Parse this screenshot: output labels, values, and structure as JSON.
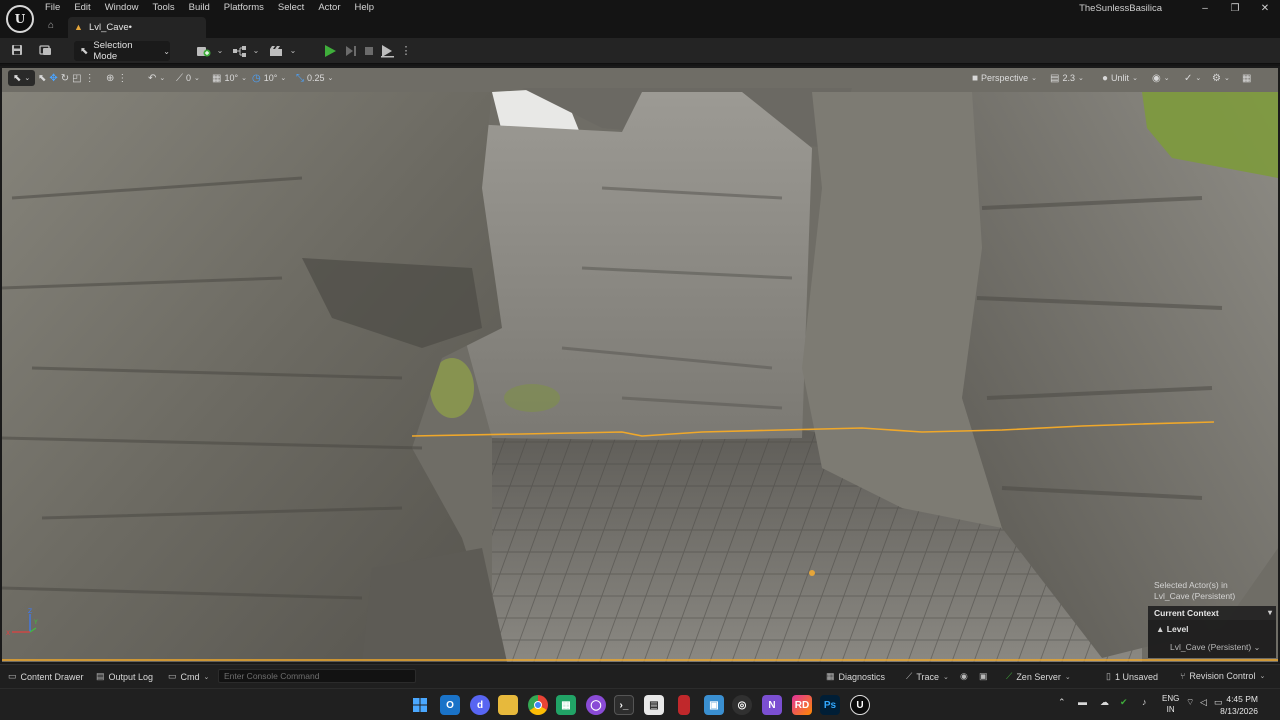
{
  "window": {
    "project_name": "TheSunlessBasilica",
    "menu": [
      "File",
      "Edit",
      "Window",
      "Tools",
      "Build",
      "Platforms",
      "Select",
      "Actor",
      "Help"
    ],
    "tab_label": "Lvl_Cave•",
    "controls": [
      "–",
      "❐",
      "✕"
    ]
  },
  "toolbar": {
    "selection_mode": "Selection Mode"
  },
  "viewport": {
    "snap_translate": "0",
    "snap_rotate": "10°",
    "snap_angle": "10°",
    "snap_scale": "0.25",
    "perspective": "Perspective",
    "camera_speed": "2.3",
    "view_mode": "Unlit",
    "selected_actors": "Selected Actor(s) in",
    "selected_level": "Lvl_Cave (Persistent)",
    "context_header": "Current Context",
    "context_level": "Level",
    "context_level_name": "Lvl_Cave (Persistent)",
    "axis_labels": [
      "Z",
      "X",
      "Y"
    ]
  },
  "statusbar": {
    "content_drawer": "Content Drawer",
    "output_log": "Output Log",
    "cmd": "Cmd",
    "console_placeholder": "Enter Console Command",
    "diagnostics": "Diagnostics",
    "trace": "Trace",
    "zen_server": "Zen Server",
    "unsaved": "1 Unsaved",
    "revision_control": "Revision Control"
  },
  "taskbar": {
    "language_top": "ENG",
    "language_bottom": "IN",
    "time": "4:45 PM",
    "date": "8/13/2026",
    "apps": [
      "start",
      "outlook",
      "discord",
      "explorer",
      "chrome",
      "sheets",
      "github",
      "terminal",
      "notes",
      "photos",
      "app-red",
      "cursor",
      "copilot",
      "visual-studio",
      "rider",
      "photoshop",
      "unreal"
    ]
  },
  "colors": {
    "accent_orange": "#e5a53a",
    "play_green": "#3fae3b",
    "selection_outline": "#f0a82a"
  }
}
